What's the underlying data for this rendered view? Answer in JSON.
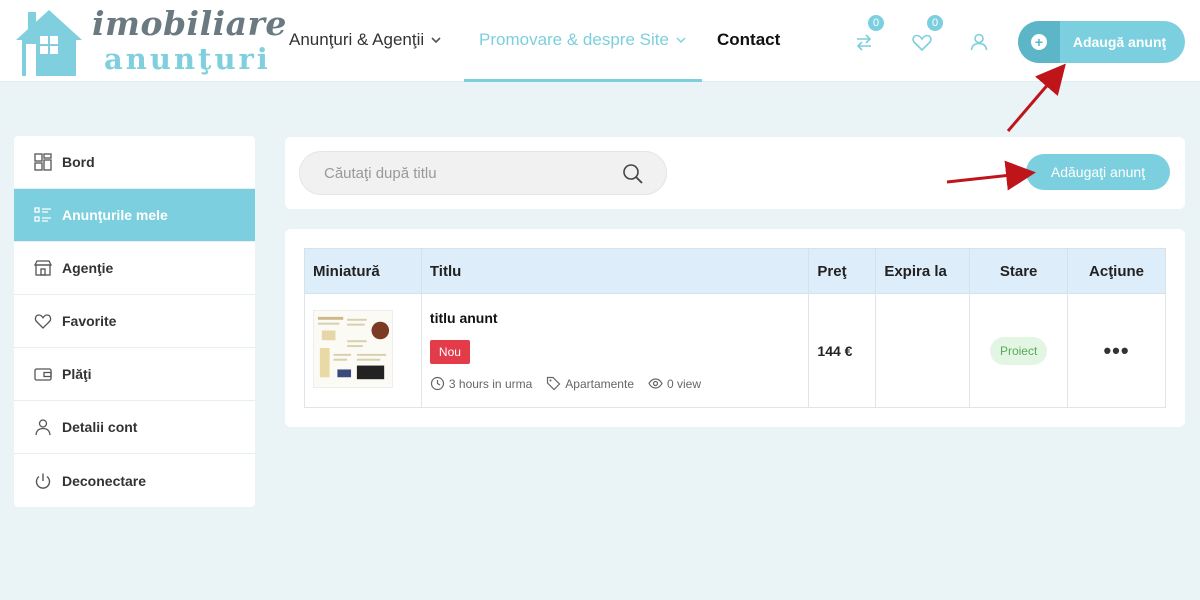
{
  "logo": {
    "line1": "imobiliare",
    "line2": "anunţuri"
  },
  "nav": {
    "item1": "Anunţuri & Agenţii",
    "item2": "Promovare & despre Site",
    "item3": "Contact"
  },
  "header": {
    "compare_count": "0",
    "favorites_count": "0",
    "add_button": "Adaugă anunţ"
  },
  "sidebar": {
    "items": [
      {
        "label": "Bord",
        "icon": "dashboard-icon"
      },
      {
        "label": "Anunţurile mele",
        "icon": "list-icon",
        "active": true
      },
      {
        "label": "Agenţie",
        "icon": "store-icon"
      },
      {
        "label": "Favorite",
        "icon": "heart-icon"
      },
      {
        "label": "Plăţi",
        "icon": "wallet-icon"
      },
      {
        "label": "Detalii cont",
        "icon": "user-icon"
      },
      {
        "label": "Deconectare",
        "icon": "power-icon"
      }
    ]
  },
  "search": {
    "placeholder": "Căutaţi după titlu",
    "add_button": "Adăugaţi anunţ"
  },
  "table": {
    "headers": [
      "Miniatură",
      "Titlu",
      "Preţ",
      "Expira la",
      "Stare",
      "Acţiune"
    ],
    "rows": [
      {
        "title": "titlu anunt",
        "badge": "Nou",
        "time": "3 hours in urma",
        "category": "Apartamente",
        "views": "0 view",
        "price": "144 €",
        "expires": "",
        "status": "Proiect",
        "action": "•••"
      }
    ]
  },
  "colors": {
    "accent": "#7ccfde",
    "badge_red": "#e43b4b",
    "status_green": "#5aa85a",
    "arrow": "#c0141b"
  }
}
